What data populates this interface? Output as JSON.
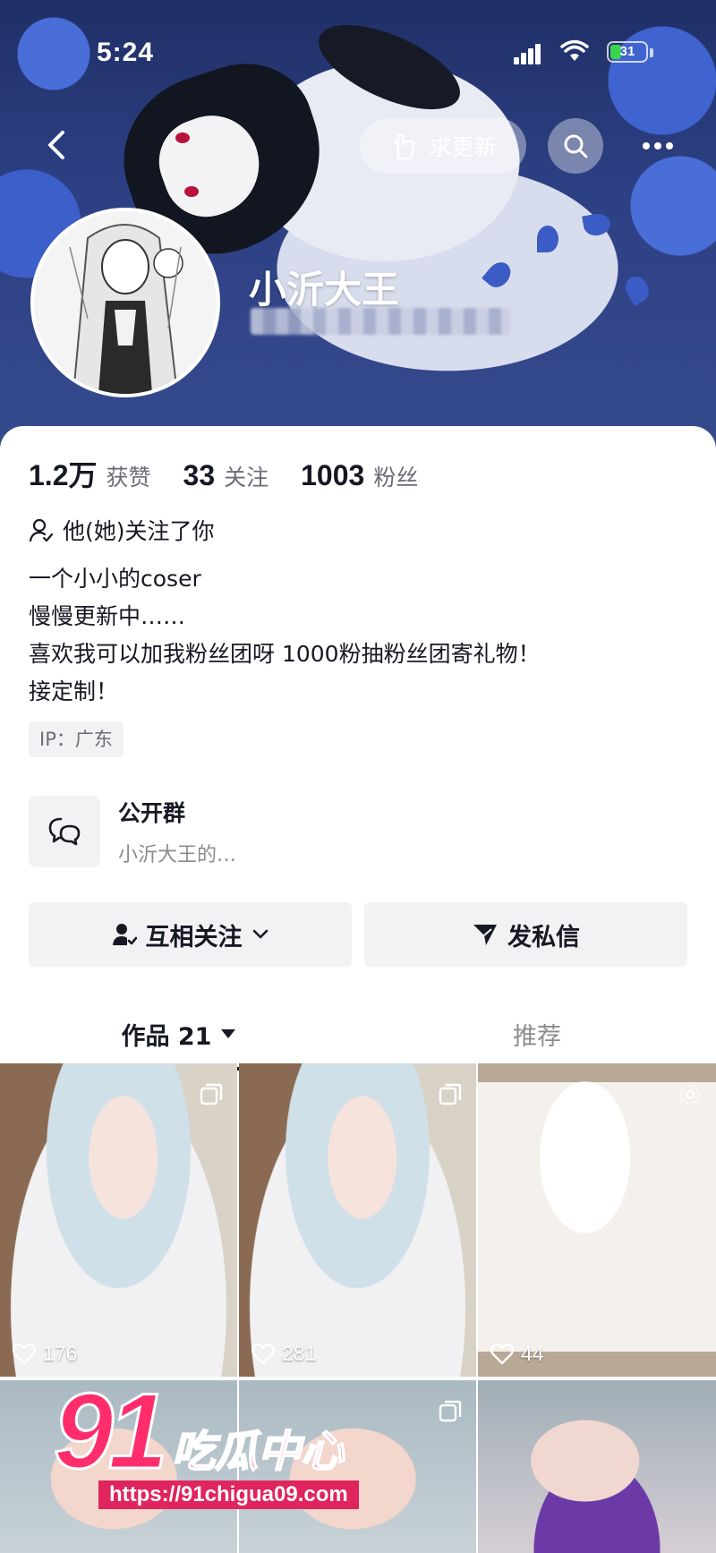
{
  "status_bar": {
    "time": "5:24",
    "battery": "31"
  },
  "header": {
    "request_update_label": "求更新",
    "nickname": "小沂大王"
  },
  "stats": [
    {
      "value": "1.2万",
      "label": "获赞"
    },
    {
      "value": "33",
      "label": "关注"
    },
    {
      "value": "1003",
      "label": "粉丝"
    }
  ],
  "follows_you": "他(她)关注了你",
  "bio": {
    "line1": "一个小小的coser",
    "line2": "慢慢更新中……",
    "line3": "喜欢我可以加我粉丝团呀 1000粉抽粉丝团寄礼物！",
    "line4": "接定制！"
  },
  "ip": "IP：广东",
  "group": {
    "title": "公开群",
    "subtitle": "小沂大王的…"
  },
  "buttons": {
    "mutual_follow": "互相关注",
    "message": "发私信"
  },
  "tabs": {
    "works": "作品 21",
    "recommend": "推荐"
  },
  "posts": [
    {
      "likes": "176"
    },
    {
      "likes": "281"
    },
    {
      "likes": "44"
    }
  ],
  "watermark": {
    "brand": "91",
    "brand_cn": "吃瓜中心",
    "url": "https://91chigua09.com"
  },
  "colors": {
    "accent": "#ff2d6b",
    "text": "#161823",
    "muted": "#8a8b91"
  }
}
